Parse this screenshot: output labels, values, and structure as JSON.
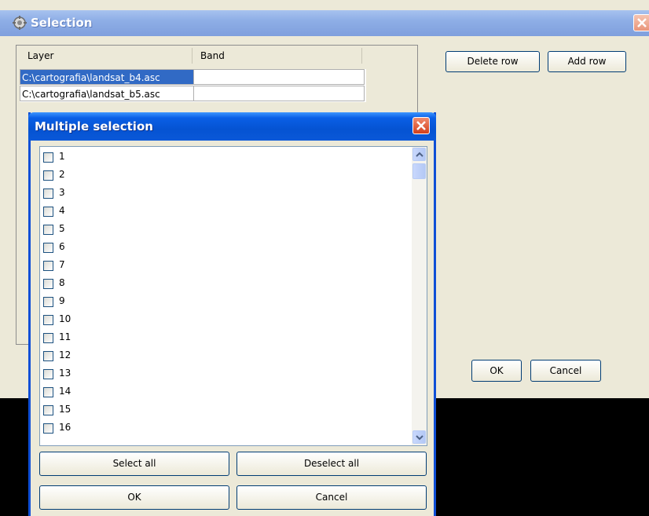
{
  "main_window": {
    "title": "Selection",
    "table": {
      "headers": [
        "Layer",
        "Band"
      ],
      "rows": [
        {
          "layer": "C:\\cartografia\\landsat_b4.asc",
          "band": "",
          "browse_label": "..."
        },
        {
          "layer": "C:\\cartografia\\landsat_b5.asc",
          "band": ""
        }
      ]
    },
    "delete_row_label": "Delete row",
    "add_row_label": "Add row",
    "ok_label": "OK",
    "cancel_label": "Cancel"
  },
  "dialog": {
    "title": "Multiple selection",
    "items": [
      {
        "label": "1",
        "checked": false
      },
      {
        "label": "2",
        "checked": false
      },
      {
        "label": "3",
        "checked": false
      },
      {
        "label": "4",
        "checked": false
      },
      {
        "label": "5",
        "checked": false
      },
      {
        "label": "6",
        "checked": false
      },
      {
        "label": "7",
        "checked": false
      },
      {
        "label": "8",
        "checked": false
      },
      {
        "label": "9",
        "checked": false
      },
      {
        "label": "10",
        "checked": false
      },
      {
        "label": "11",
        "checked": false
      },
      {
        "label": "12",
        "checked": false
      },
      {
        "label": "13",
        "checked": false
      },
      {
        "label": "14",
        "checked": false
      },
      {
        "label": "15",
        "checked": false
      },
      {
        "label": "16",
        "checked": false
      }
    ],
    "select_all_label": "Select all",
    "deselect_all_label": "Deselect all",
    "ok_label": "OK",
    "cancel_label": "Cancel"
  },
  "icons": {
    "app": "app-icon",
    "close": "close-icon",
    "scroll_up": "chevron-up-icon",
    "scroll_down": "chevron-down-icon"
  },
  "colors": {
    "selection_highlight": "#316ac5",
    "dialog_titlebar": "#0553d2",
    "inactive_titlebar": "#8eaee6",
    "window_bg": "#ece9d8"
  }
}
